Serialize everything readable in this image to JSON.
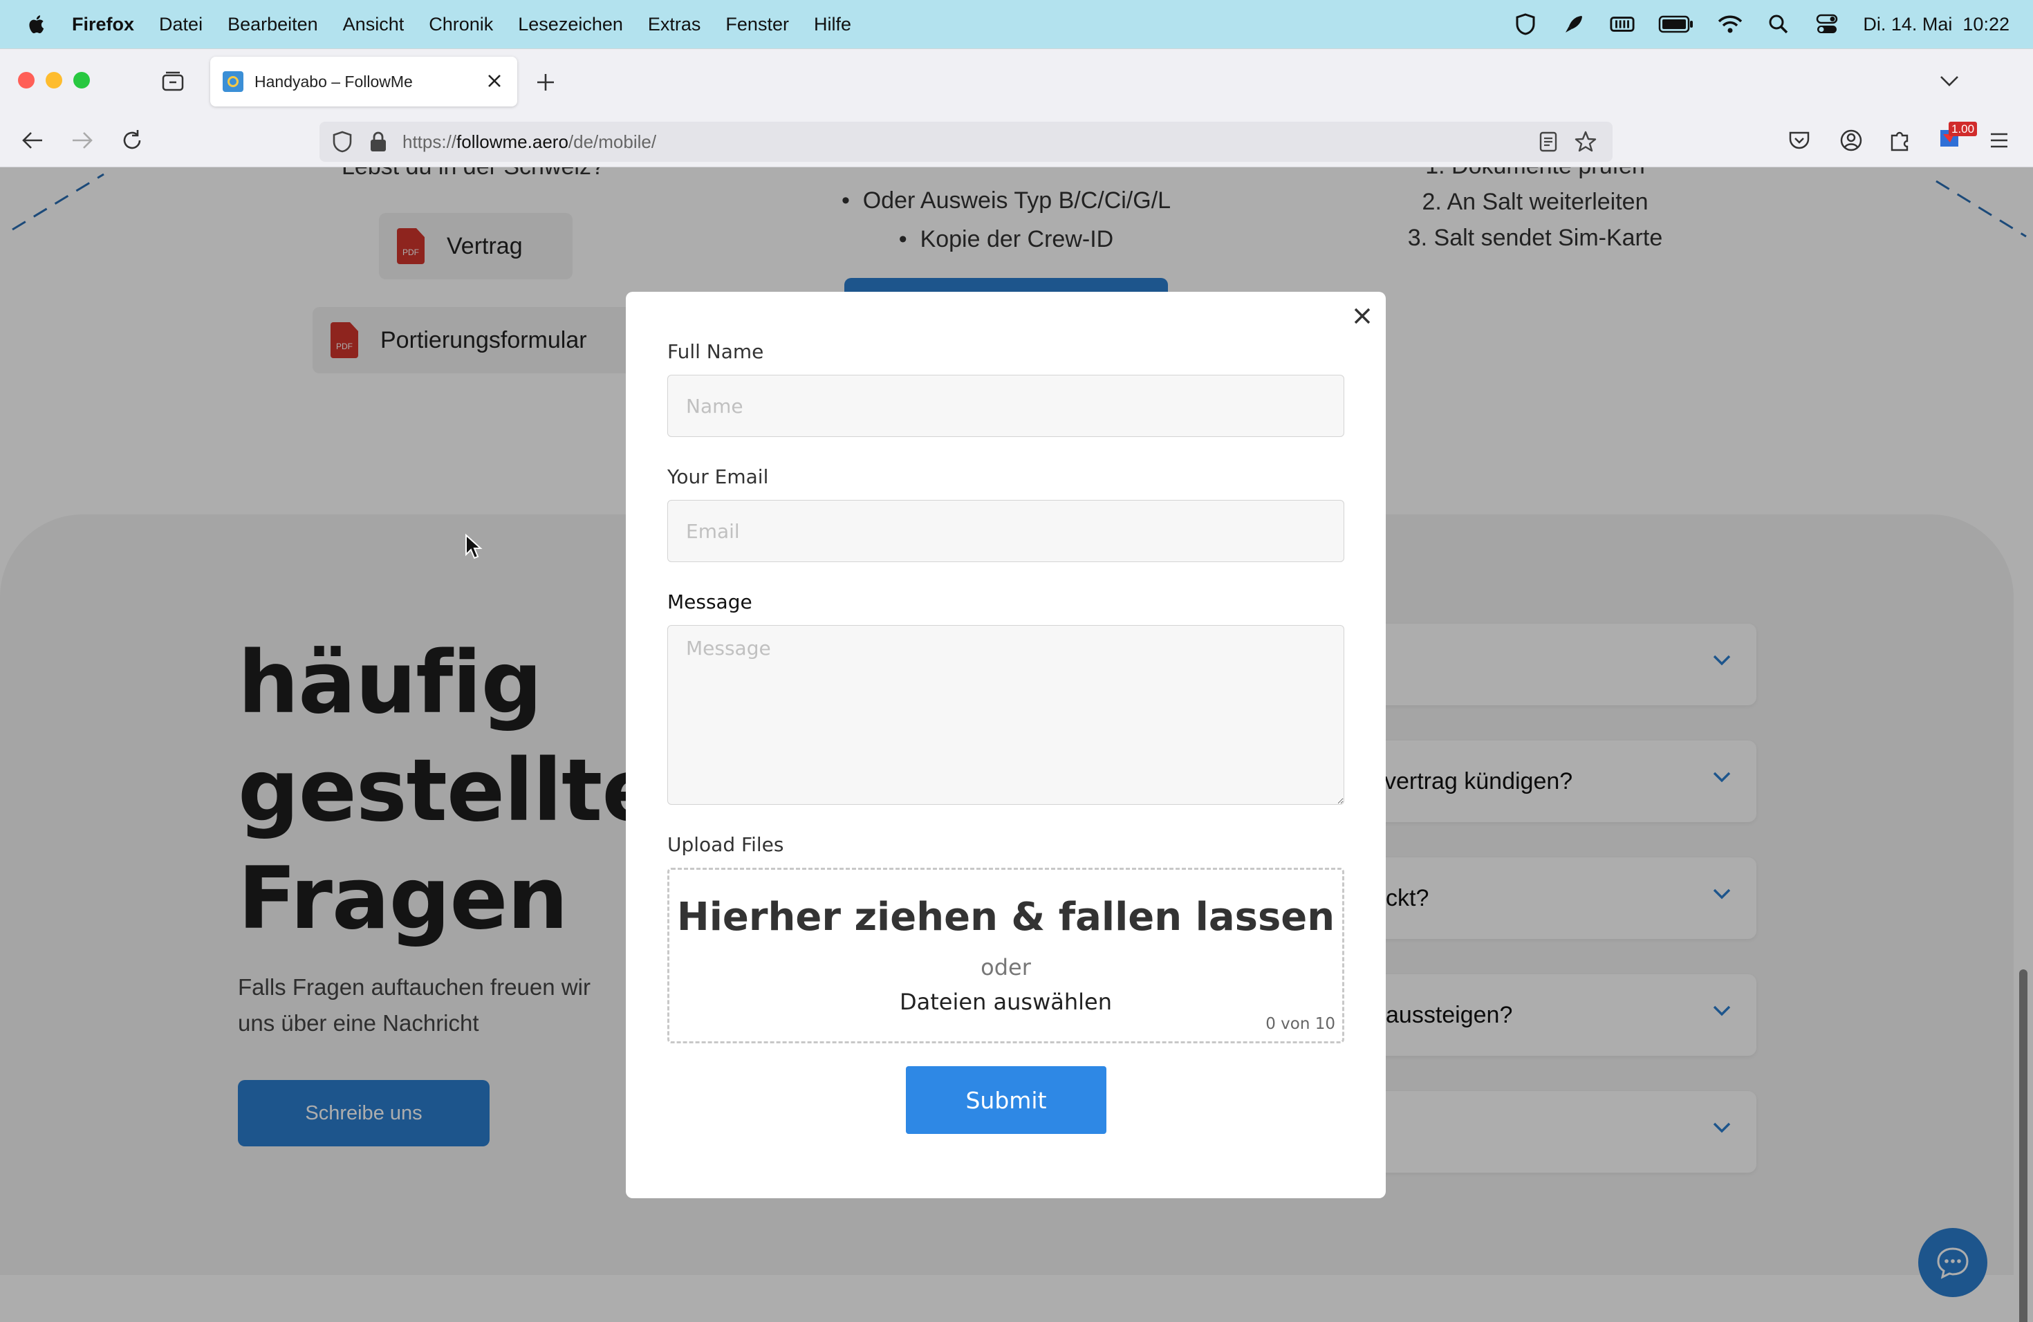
{
  "menubar": {
    "app": "Firefox",
    "items": [
      "Datei",
      "Bearbeiten",
      "Ansicht",
      "Chronik",
      "Lesezeichen",
      "Extras",
      "Fenster",
      "Hilfe"
    ],
    "clock": "Di. 14. Mai  10:22"
  },
  "browser": {
    "tab_title": "Handyabo – FollowMe",
    "url_prefix": "https://",
    "url_domain": "followme.aero",
    "url_path": "/de/mobile/",
    "ext_badge": "1.00"
  },
  "page": {
    "top_left_partial": "Lebst du in der Schweiz?",
    "docs": [
      "Vertrag",
      "Portierungsformular"
    ],
    "pdf_tag": "PDF",
    "bullets": [
      "Oder Ausweis Typ B/C/Ci/G/L",
      "Kopie der Crew-ID"
    ],
    "steps_partial": "1. Dokumente prüfen",
    "steps": [
      "2. An Salt weiterleiten",
      "3. Salt sendet Sim-Karte"
    ],
    "faq_heading": [
      "häufig",
      "gestellte",
      "Fragen"
    ],
    "faq_sub": "Falls Fragen auftauchen freuen wir uns über eine Nachricht",
    "faq_button": "Schreibe uns",
    "faq_items": [
      "",
      "vertrag kündigen?",
      "ckt?",
      "aussteigen?",
      ""
    ]
  },
  "modal": {
    "name_label": "Full Name",
    "name_placeholder": "Name",
    "email_label": "Your Email",
    "email_placeholder": "Email",
    "message_label": "Message",
    "message_placeholder": "Message",
    "upload_label": "Upload Files",
    "drop_title": "Hierher ziehen & fallen lassen",
    "drop_or": "oder",
    "drop_choose": "Dateien auswählen",
    "file_count": "0 von 10",
    "submit": "Submit"
  },
  "colors": {
    "accent": "#2e88e5",
    "faq_button": "#2c7ecf",
    "menubar": "#b3e2ee"
  }
}
